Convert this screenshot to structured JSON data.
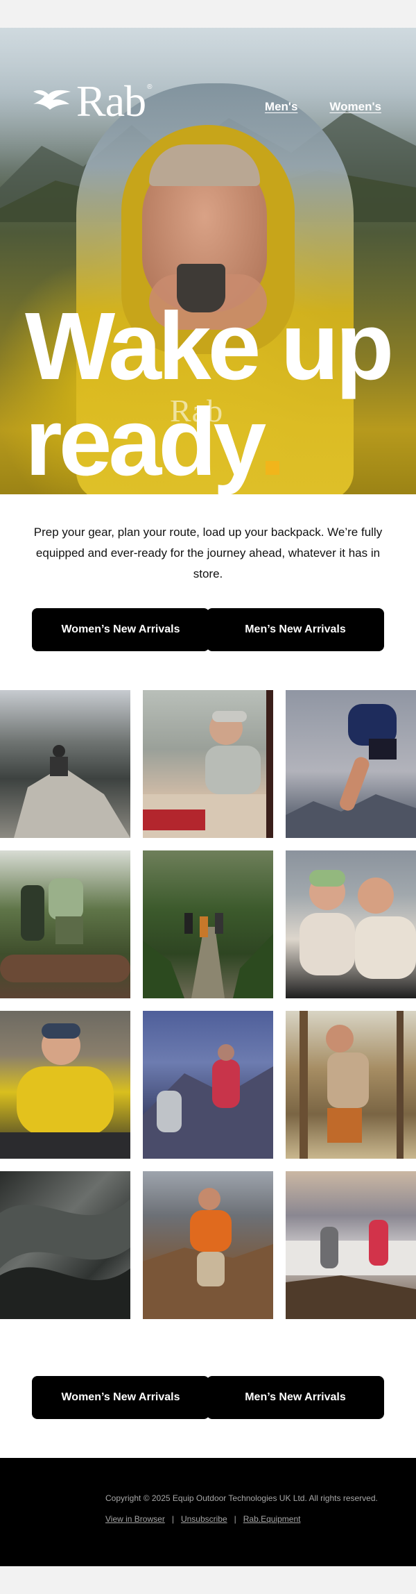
{
  "brand": {
    "name": "Rab",
    "registered": "®"
  },
  "nav": {
    "mens": "Men's",
    "womens": "Women's"
  },
  "hero": {
    "line1": "Wake up",
    "line2": "ready",
    "bag_logo": "Rab",
    "accent_color": "#f1b51b"
  },
  "intro": {
    "text": "Prep your gear, plan your route, load up your backpack. We’re fully equipped and ever-ready for the journey ahead, whatever it has in store."
  },
  "cta_top": {
    "womens": "Women’s New Arrivals",
    "mens": "Men’s New Arrivals"
  },
  "cta_bottom": {
    "womens": "Women’s New Arrivals",
    "mens": "Men’s New Arrivals"
  },
  "grid": [
    "climber on rocky ridge",
    "woman in cap relaxing in tent",
    "runner leaping over mountains",
    "hikers crossing log in forest",
    "group hiking forest trail",
    "two friends smiling in tent",
    "man in yellow puffer jacket",
    "hikers on ridge at dusk",
    "hiker in forest with pack",
    "close-up of wet fabric",
    "hiker in orange on trail",
    "two hikers above clouds"
  ],
  "footer": {
    "copyright": "Copyright © 2025 Equip Outdoor Technologies UK Ltd. All rights reserved.",
    "view_in_browser": "View in Browser",
    "unsubscribe": "Unsubscribe",
    "site": "Rab.Equipment",
    "sep1": "|",
    "sep2": "|"
  }
}
